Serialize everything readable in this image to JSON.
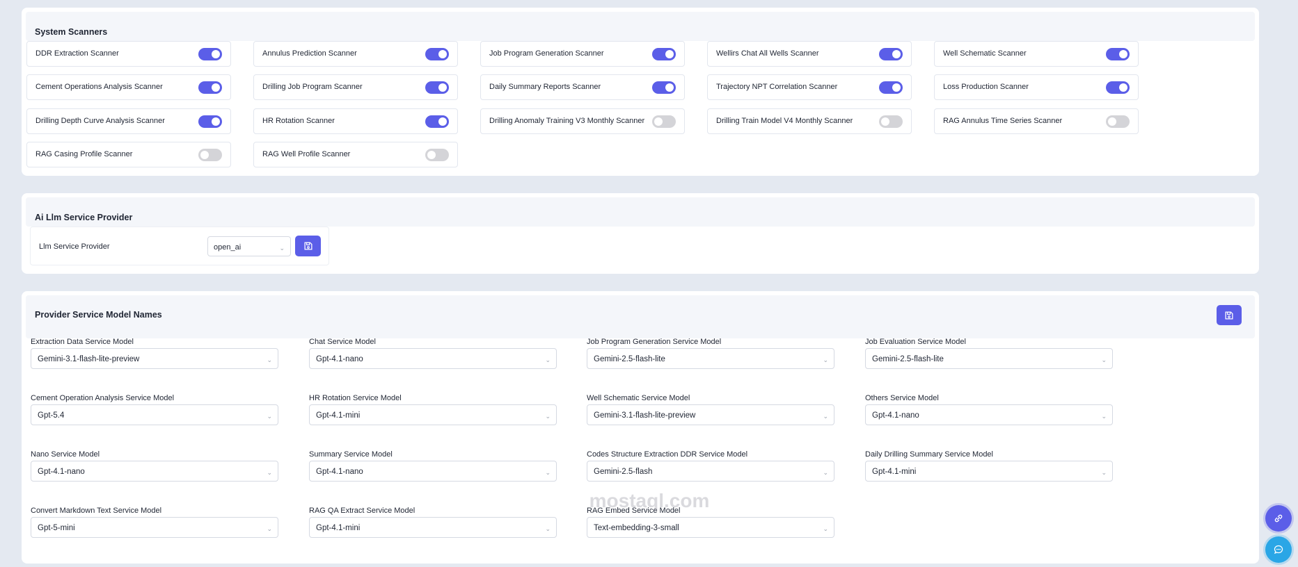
{
  "scanners": {
    "title": "System Scanners",
    "items": [
      {
        "label": "DDR Extraction Scanner",
        "on": true
      },
      {
        "label": "Annulus Prediction Scanner",
        "on": true
      },
      {
        "label": "Job Program Generation Scanner",
        "on": true
      },
      {
        "label": "Wellirs Chat All Wells Scanner",
        "on": true
      },
      {
        "label": "Well Schematic Scanner",
        "on": true
      },
      {
        "label": "Cement Operations Analysis Scanner",
        "on": true
      },
      {
        "label": "Drilling Job Program Scanner",
        "on": true
      },
      {
        "label": "Daily Summary Reports Scanner",
        "on": true
      },
      {
        "label": "Trajectory NPT Correlation Scanner",
        "on": true
      },
      {
        "label": "Loss Production Scanner",
        "on": true
      },
      {
        "label": "Drilling Depth Curve Analysis Scanner",
        "on": true
      },
      {
        "label": "HR Rotation Scanner",
        "on": true
      },
      {
        "label": "Drilling Anomaly Training V3 Monthly Scanner",
        "on": false
      },
      {
        "label": "Drilling Train Model V4 Monthly Scanner",
        "on": false
      },
      {
        "label": "RAG Annulus Time Series Scanner",
        "on": false
      },
      {
        "label": "RAG Casing Profile Scanner",
        "on": false
      },
      {
        "label": "RAG Well Profile Scanner",
        "on": false
      }
    ]
  },
  "provider": {
    "title": "Ai Llm Service Provider",
    "label": "Llm Service Provider",
    "value": "open_ai",
    "save_icon": "save-icon"
  },
  "models": {
    "title": "Provider Service Model Names",
    "save_icon": "save-icon",
    "fields": [
      {
        "label": "Extraction Data Service Model",
        "value": "Gemini-3.1-flash-lite-preview"
      },
      {
        "label": "Chat Service Model",
        "value": "Gpt-4.1-nano"
      },
      {
        "label": "Job Program Generation Service Model",
        "value": "Gemini-2.5-flash-lite"
      },
      {
        "label": "Job Evaluation Service Model",
        "value": "Gemini-2.5-flash-lite"
      },
      {
        "label": "Cement Operation Analysis Service Model",
        "value": "Gpt-5.4"
      },
      {
        "label": "HR Rotation Service Model",
        "value": "Gpt-4.1-mini"
      },
      {
        "label": "Well Schematic Service Model",
        "value": "Gemini-3.1-flash-lite-preview"
      },
      {
        "label": "Others Service Model",
        "value": "Gpt-4.1-nano"
      },
      {
        "label": "Nano Service Model",
        "value": "Gpt-4.1-nano"
      },
      {
        "label": "Summary Service Model",
        "value": "Gpt-4.1-nano"
      },
      {
        "label": "Codes Structure Extraction DDR Service Model",
        "value": "Gemini-2.5-flash"
      },
      {
        "label": "Daily Drilling Summary Service Model",
        "value": "Gpt-4.1-mini"
      },
      {
        "label": "Convert Markdown Text Service Model",
        "value": "Gpt-5-mini"
      },
      {
        "label": "RAG QA Extract Service Model",
        "value": "Gpt-4.1-mini"
      },
      {
        "label": "RAG Embed Service Model",
        "value": "Text-embedding-3-small"
      }
    ]
  },
  "watermark": {
    "text": "mostaql.com"
  },
  "fabs": {
    "link_icon": "link-icon",
    "chat_icon": "chat-icon"
  },
  "colors": {
    "accent": "#5b5ee8",
    "toggle_off": "#d4d4d8",
    "background": "#e4e9f1"
  }
}
